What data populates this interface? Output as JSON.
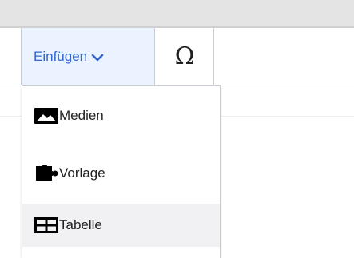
{
  "toolbar": {
    "insert_label": "Einfügen",
    "special_char_label": "Ω"
  },
  "insert_menu": {
    "items": [
      {
        "label": "Medien",
        "icon": "image-icon"
      },
      {
        "label": "Vorlage",
        "icon": "puzzle-icon"
      },
      {
        "label": "Tabelle",
        "icon": "table-icon"
      }
    ]
  },
  "colors": {
    "accent": "#3366cc",
    "active_tool_bg": "#eaf3ff",
    "hover_bg": "#f1f1f3",
    "border": "#c8ccd1"
  }
}
